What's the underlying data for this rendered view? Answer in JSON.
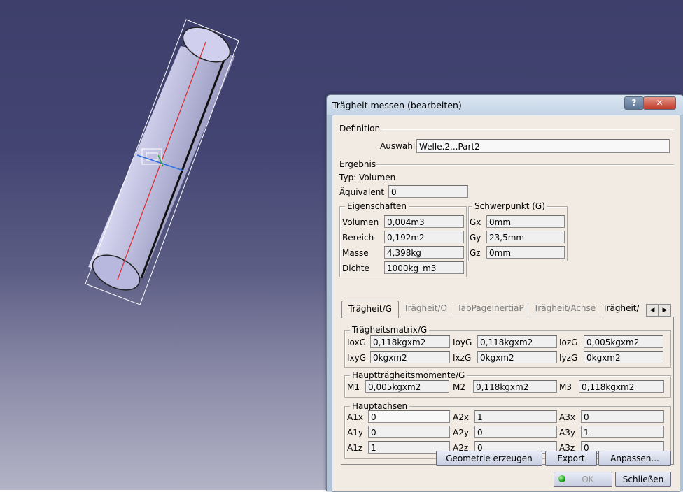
{
  "dialog": {
    "title": "Trägheit messen (bearbeiten)",
    "help_label": "?",
    "close_label": "✕",
    "definition": {
      "section_label": "Definition",
      "selection_label": "Auswahl:",
      "selection_value": "Welle.2...Part2"
    },
    "result": {
      "section_label": "Ergebnis",
      "type_text": "Typ: Volumen",
      "equivalent_label": "Äquivalent",
      "equivalent_value": "0"
    },
    "properties": {
      "title": "Eigenschaften",
      "rows": [
        {
          "label": "Volumen",
          "value": "0,004m3"
        },
        {
          "label": "Bereich",
          "value": "0,192m2"
        },
        {
          "label": "Masse",
          "value": "4,398kg"
        },
        {
          "label": "Dichte",
          "value": "1000kg_m3"
        }
      ]
    },
    "center_of_gravity": {
      "title": "Schwerpunkt (G)",
      "rows": [
        {
          "label": "Gx",
          "value": "0mm"
        },
        {
          "label": "Gy",
          "value": "23,5mm"
        },
        {
          "label": "Gz",
          "value": "0mm"
        }
      ]
    },
    "tabs": [
      {
        "label": "Trägheit/G",
        "active": true
      },
      {
        "label": "Trägheit/O",
        "active": false
      },
      {
        "label": "TabPageInertiaP",
        "active": false
      },
      {
        "label": "Trägheit/Achse",
        "active": false
      },
      {
        "label": "Trägheit/A",
        "active": false
      }
    ],
    "scroll_left": "◀",
    "scroll_right": "▶",
    "inertia_matrix": {
      "title": "Trägheitsmatrix/G",
      "rows": [
        [
          {
            "label": "IoxG",
            "value": "0,118kgxm2"
          },
          {
            "label": "IoyG",
            "value": "0,118kgxm2"
          },
          {
            "label": "IozG",
            "value": "0,005kgxm2"
          }
        ],
        [
          {
            "label": "IxyG",
            "value": "0kgxm2"
          },
          {
            "label": "IxzG",
            "value": "0kgxm2"
          },
          {
            "label": "IyzG",
            "value": "0kgxm2"
          }
        ]
      ]
    },
    "principal_moments": {
      "title": "Hauptträgheitsmomente/G",
      "items": [
        {
          "label": "M1",
          "value": "0,005kgxm2"
        },
        {
          "label": "M2",
          "value": "0,118kgxm2"
        },
        {
          "label": "M3",
          "value": "0,118kgxm2"
        }
      ]
    },
    "principal_axes": {
      "title": "Hauptachsen",
      "rows": [
        [
          {
            "label": "A1x",
            "value": "0"
          },
          {
            "label": "A2x",
            "value": "1"
          },
          {
            "label": "A3x",
            "value": "0"
          }
        ],
        [
          {
            "label": "A1y",
            "value": "0"
          },
          {
            "label": "A2y",
            "value": "0"
          },
          {
            "label": "A3y",
            "value": "1"
          }
        ],
        [
          {
            "label": "A1z",
            "value": "1"
          },
          {
            "label": "A2z",
            "value": "0"
          },
          {
            "label": "A3z",
            "value": "0"
          }
        ]
      ]
    },
    "buttons": {
      "create_geometry": "Geometrie erzeugen",
      "export": "Export",
      "customize": "Anpassen...",
      "ok": "OK",
      "close": "Schließen"
    }
  },
  "viewport": {
    "part_color": "#c9c9e8",
    "axis_red": "#e0262a",
    "axis_blue": "#2a6de0",
    "axis_green": "#29a63a"
  }
}
